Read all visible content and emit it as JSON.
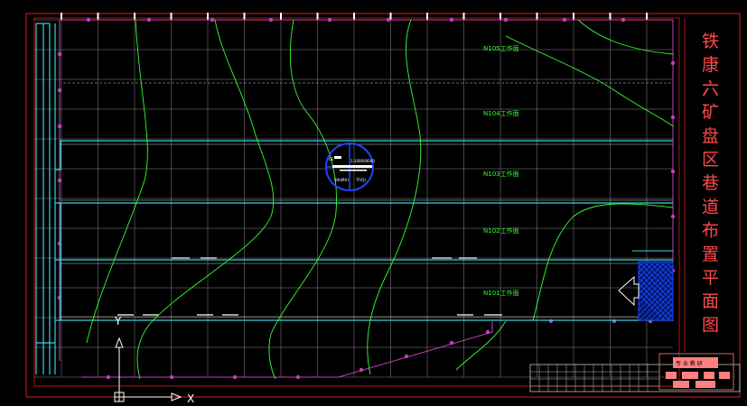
{
  "title": {
    "chars": [
      "铁",
      "康",
      "六",
      "矿",
      "盘",
      "区",
      "巷",
      "道",
      "布",
      "置",
      "平",
      "面",
      "图"
    ]
  },
  "panels": [
    {
      "id": "n105",
      "label": "N105工作面"
    },
    {
      "id": "n104",
      "label": "N104工作面"
    },
    {
      "id": "n103",
      "label": "N103工作面"
    },
    {
      "id": "n102",
      "label": "N102工作面"
    },
    {
      "id": "n101",
      "label": "N101工作面"
    }
  ],
  "legend": {
    "line1": "CE",
    "line2": "1:100000000",
    "line3": "SIA(MA)",
    "line4": "TF(Q)"
  },
  "axes": {
    "x_label": "X",
    "y_label": "Y"
  },
  "title_block": {
    "header": "专 业 教 研"
  },
  "colors": {
    "background": "#000000",
    "border": "#d02020",
    "grid": "#8a8a8a",
    "roadway": "#33d6e0",
    "contour": "#33ff33",
    "boundary": "#c040c0",
    "title": "#ff4a4a",
    "hatch": "#2244ff",
    "titleblock": "#ff8080"
  }
}
